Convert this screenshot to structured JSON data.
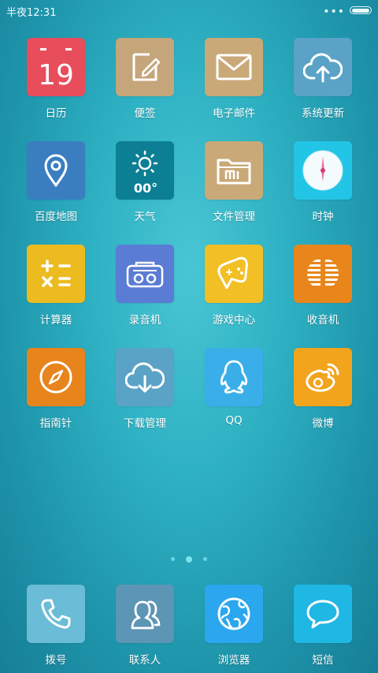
{
  "status_bar": {
    "time": "半夜12:31",
    "more": "•••"
  },
  "pages": {
    "count": 3,
    "active": 2
  },
  "apps": [
    {
      "label": "日历",
      "icon": "calendar-icon",
      "date_number": "19",
      "color": "#e84d5b"
    },
    {
      "label": "便签",
      "icon": "notes-icon",
      "color": "#c4a67a"
    },
    {
      "label": "电子邮件",
      "icon": "mail-icon",
      "color": "#c9a978"
    },
    {
      "label": "系统更新",
      "icon": "cloud-upload-icon",
      "color": "#5aa3c6"
    },
    {
      "label": "百度地图",
      "icon": "map-pin-icon",
      "color": "#3a7ec0"
    },
    {
      "label": "天气",
      "icon": "sun-icon",
      "temperature": "00°",
      "color": "#0d7f94"
    },
    {
      "label": "文件管理",
      "icon": "folder-icon",
      "color": "#c9a978"
    },
    {
      "label": "时钟",
      "icon": "clock-icon",
      "color": "#23c5e6"
    },
    {
      "label": "计算器",
      "icon": "calculator-icon",
      "color": "#ecbb20"
    },
    {
      "label": "录音机",
      "icon": "recorder-icon",
      "color": "#5a7cd4"
    },
    {
      "label": "游戏中心",
      "icon": "gamepad-icon",
      "color": "#f2bf24"
    },
    {
      "label": "收音机",
      "icon": "radio-icon",
      "color": "#e8861c"
    },
    {
      "label": "指南针",
      "icon": "compass-icon",
      "color": "#e8841c"
    },
    {
      "label": "下载管理",
      "icon": "cloud-download-icon",
      "color": "#5aa3c6"
    },
    {
      "label": "QQ",
      "icon": "qq-penguin-icon",
      "color": "#3aaee8"
    },
    {
      "label": "微博",
      "icon": "weibo-icon",
      "color": "#f2a41c"
    }
  ],
  "dock": [
    {
      "label": "拨号",
      "icon": "phone-icon",
      "color": "#6bbcd6"
    },
    {
      "label": "联系人",
      "icon": "contacts-icon",
      "color": "#5d95b4"
    },
    {
      "label": "浏览器",
      "icon": "browser-globe-icon",
      "color": "#2aa7ee"
    },
    {
      "label": "短信",
      "icon": "message-icon",
      "color": "#1fb7e4"
    }
  ]
}
